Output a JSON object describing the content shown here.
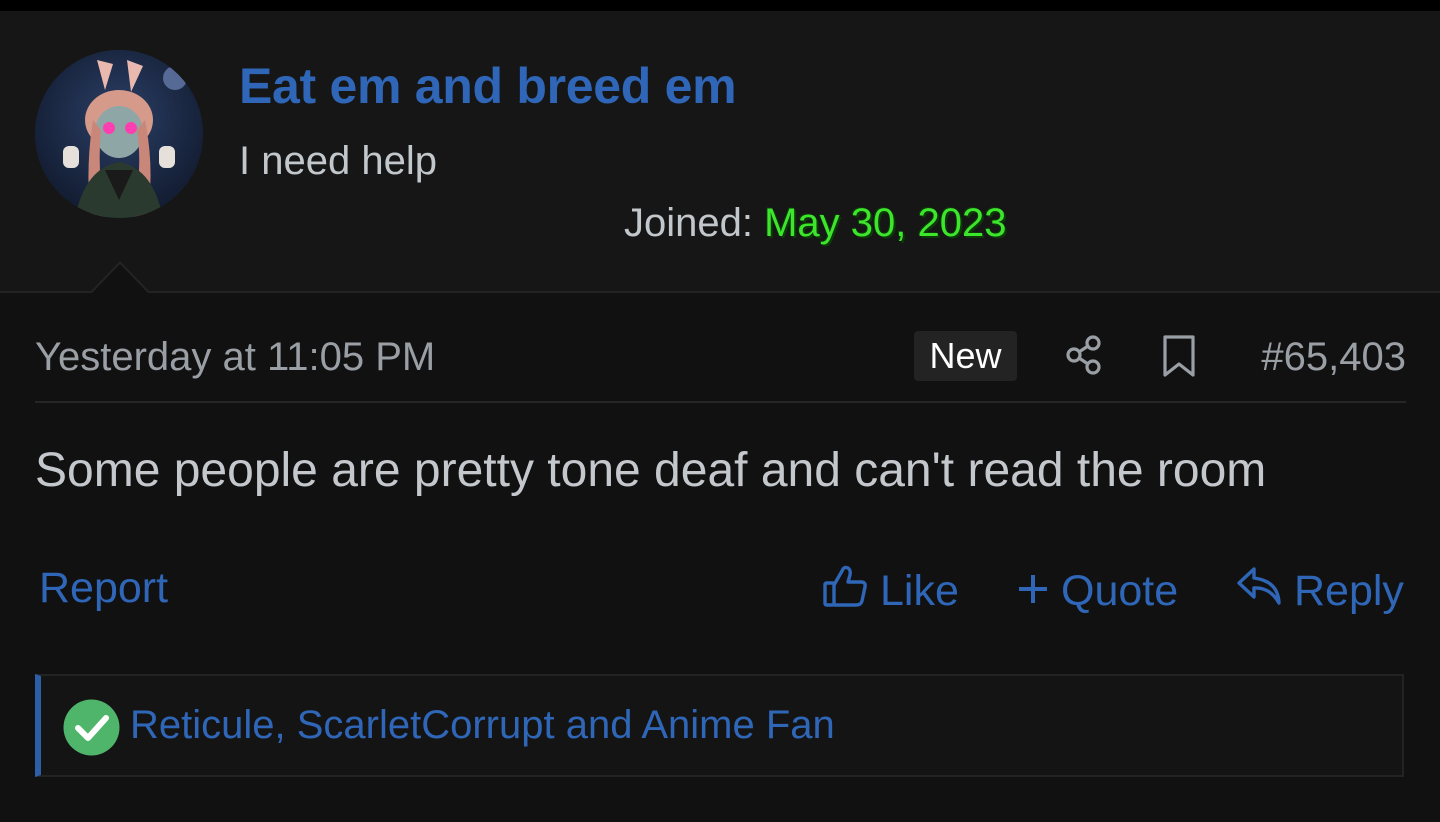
{
  "user": {
    "name": "Eat em and breed em",
    "title": "I need help",
    "joined_label": "Joined:",
    "joined_date": "May 30, 2023"
  },
  "post": {
    "timestamp": "Yesterday at 11:05 PM",
    "badge": "New",
    "number": "#65,403",
    "body": "Some people are pretty tone deaf and can't read the room"
  },
  "actions": {
    "report": "Report",
    "like": "Like",
    "quote": "Quote",
    "reply": "Reply"
  },
  "reactions": {
    "names": "Reticule, ScarletCorrupt and Anime Fan"
  },
  "icons": {
    "share": "share-icon",
    "bookmark": "bookmark-icon",
    "like": "thumbs-up-icon",
    "quote": "plus-icon",
    "reply": "reply-arrow-icon",
    "reaction": "check-circle-icon"
  },
  "colors": {
    "link": "#2f66b7",
    "joined_date": "#3de52c",
    "background": "#111111",
    "reaction_check": "#4fb56a"
  }
}
